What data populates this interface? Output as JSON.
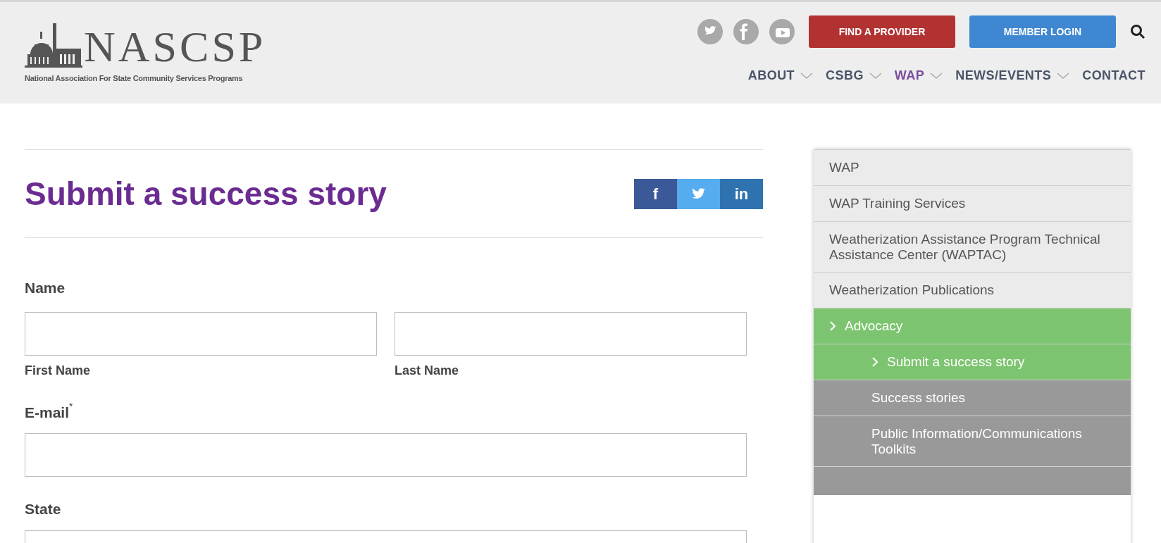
{
  "header": {
    "logo": {
      "wordmark": "NASCSP",
      "tagline": "National Association For State Community Services Programs"
    },
    "social": [
      {
        "kind": "twitter"
      },
      {
        "kind": "facebook"
      },
      {
        "kind": "youtube"
      }
    ],
    "buttons": [
      {
        "label": "FIND A PROVIDER",
        "kind": "red"
      },
      {
        "label": "MEMBER LOGIN",
        "kind": "blue"
      }
    ],
    "nav": [
      {
        "label": "ABOUT",
        "dropdown": true,
        "selected": false
      },
      {
        "label": "CSBG",
        "dropdown": true,
        "selected": false
      },
      {
        "label": "WAP",
        "dropdown": true,
        "selected": true
      },
      {
        "label": "NEWS/EVENTS",
        "dropdown": true,
        "selected": false
      },
      {
        "label": "CONTACT",
        "dropdown": false,
        "selected": false
      }
    ]
  },
  "page": {
    "title": "Submit a success story",
    "share": [
      {
        "kind": "facebook",
        "label": "f"
      },
      {
        "kind": "twitter"
      },
      {
        "kind": "linkedin",
        "label": "in"
      }
    ],
    "form": [
      {
        "kind": "name",
        "label": "Name",
        "fields": [
          {
            "sublabel": "First Name"
          },
          {
            "sublabel": "Last Name"
          }
        ]
      },
      {
        "kind": "text",
        "label": "E-mail",
        "required_mark": "*"
      },
      {
        "kind": "text",
        "label": "State"
      }
    ]
  },
  "sidebar": {
    "items": [
      {
        "label": "WAP",
        "selected": false
      },
      {
        "label": "WAP Training Services",
        "selected": false
      },
      {
        "label": "Weatherization Assistance Program Technical Assistance Center (WAPTAC)",
        "selected": false
      },
      {
        "label": "Weatherization Publications",
        "selected": false
      },
      {
        "label": "Advocacy",
        "selected": true,
        "children": [
          {
            "label": "Submit a success story",
            "selected": true
          },
          {
            "label": "Success stories",
            "selected": false
          },
          {
            "label": "Public Information/Communications Toolkits",
            "selected": false
          }
        ]
      }
    ]
  }
}
